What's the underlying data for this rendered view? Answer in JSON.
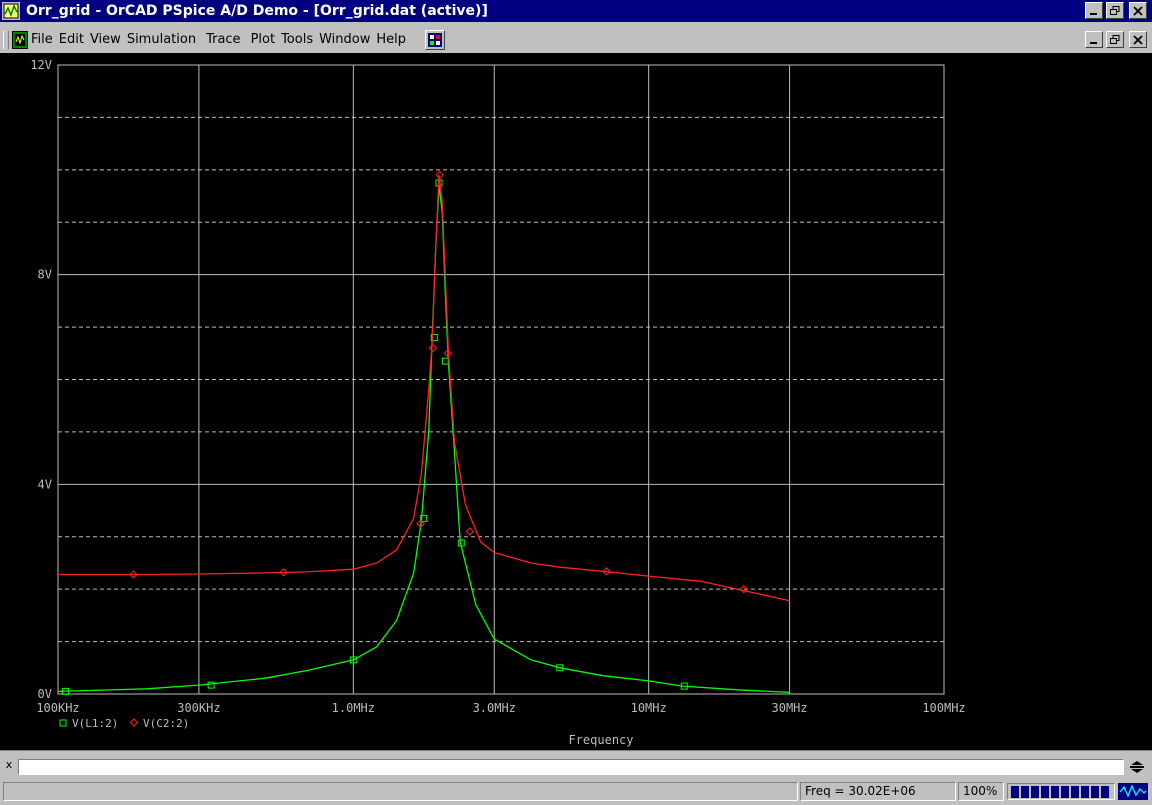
{
  "window": {
    "title": "Orr_grid - OrCAD PSpice A/D Demo  - [Orr_grid.dat (active)]"
  },
  "menu": {
    "items": [
      "File",
      "Edit",
      "View",
      "Simulation",
      "Trace",
      "Plot",
      "Tools",
      "Window",
      "Help"
    ]
  },
  "colors": {
    "titlebar": "#000080",
    "plot_background": "#000000",
    "grid": "#bcbcbc",
    "trace_L1": "#00ff00",
    "trace_C2": "#ff2020"
  },
  "icons": {
    "app": "pspice-app-icon",
    "document": "pspice-document-icon",
    "probe": "probe-icon",
    "waveform": "waveform-icon"
  },
  "chart_data": {
    "type": "line",
    "xlabel": "Frequency",
    "xscale": "log",
    "xlim": [
      100000,
      100000000
    ],
    "ylim": [
      0,
      12
    ],
    "x_ticks": [
      {
        "value": 100000,
        "label": "100KHz"
      },
      {
        "value": 300000,
        "label": "300KHz"
      },
      {
        "value": 1000000,
        "label": "1.0MHz"
      },
      {
        "value": 3000000,
        "label": "3.0MHz"
      },
      {
        "value": 10000000,
        "label": "10MHz"
      },
      {
        "value": 30000000,
        "label": "30MHz"
      },
      {
        "value": 100000000,
        "label": "100MHz"
      }
    ],
    "y_ticks": [
      {
        "value": 0,
        "label": "0V"
      },
      {
        "value": 4,
        "label": "4V"
      },
      {
        "value": 8,
        "label": "8V"
      },
      {
        "value": 12,
        "label": "12V"
      }
    ],
    "grid": true,
    "legend_position": "bottom-left",
    "series": [
      {
        "name": "V(L1:2)",
        "marker": "square",
        "color": "#00ff00",
        "points": [
          [
            100000,
            0.05
          ],
          [
            200000,
            0.1
          ],
          [
            300000,
            0.17
          ],
          [
            500000,
            0.3
          ],
          [
            700000,
            0.45
          ],
          [
            1000000,
            0.65
          ],
          [
            1200000,
            0.9
          ],
          [
            1400000,
            1.4
          ],
          [
            1600000,
            2.3
          ],
          [
            1700000,
            3.3
          ],
          [
            1800000,
            5.0
          ],
          [
            1850000,
            6.8
          ],
          [
            1900000,
            8.5
          ],
          [
            1950000,
            9.7
          ],
          [
            2000000,
            9.2
          ],
          [
            2050000,
            7.6
          ],
          [
            2100000,
            6.3
          ],
          [
            2200000,
            4.6
          ],
          [
            2300000,
            2.9
          ],
          [
            2600000,
            1.7
          ],
          [
            3000000,
            1.05
          ],
          [
            4000000,
            0.65
          ],
          [
            5000000,
            0.5
          ],
          [
            7000000,
            0.35
          ],
          [
            10000000,
            0.25
          ],
          [
            13000000,
            0.15
          ],
          [
            20000000,
            0.08
          ],
          [
            30000000,
            0.03
          ]
        ],
        "markers_at": [
          [
            106000,
            0.05
          ],
          [
            330000,
            0.17
          ],
          [
            1000000,
            0.65
          ],
          [
            1730000,
            3.35
          ],
          [
            1880000,
            6.8
          ],
          [
            1950000,
            9.75
          ],
          [
            2050000,
            6.35
          ],
          [
            2320000,
            2.88
          ],
          [
            5000000,
            0.5
          ],
          [
            13200000,
            0.15
          ]
        ]
      },
      {
        "name": "V(C2:2)",
        "marker": "diamond",
        "color": "#ff2020",
        "points": [
          [
            100000,
            2.28
          ],
          [
            200000,
            2.28
          ],
          [
            300000,
            2.29
          ],
          [
            500000,
            2.31
          ],
          [
            700000,
            2.33
          ],
          [
            1000000,
            2.38
          ],
          [
            1200000,
            2.5
          ],
          [
            1400000,
            2.75
          ],
          [
            1600000,
            3.35
          ],
          [
            1700000,
            4.2
          ],
          [
            1800000,
            5.8
          ],
          [
            1850000,
            6.7
          ],
          [
            1900000,
            8.5
          ],
          [
            1950000,
            9.9
          ],
          [
            2000000,
            9.4
          ],
          [
            2050000,
            7.9
          ],
          [
            2100000,
            6.5
          ],
          [
            2200000,
            4.8
          ],
          [
            2400000,
            3.6
          ],
          [
            2700000,
            2.9
          ],
          [
            3000000,
            2.7
          ],
          [
            4000000,
            2.5
          ],
          [
            5000000,
            2.42
          ],
          [
            7000000,
            2.34
          ],
          [
            10000000,
            2.25
          ],
          [
            15000000,
            2.15
          ],
          [
            20000000,
            2.0
          ],
          [
            30000000,
            1.78
          ]
        ],
        "markers_at": [
          [
            180000,
            2.28
          ],
          [
            580000,
            2.32
          ],
          [
            1690000,
            3.25
          ],
          [
            1860000,
            6.6
          ],
          [
            1960000,
            9.9
          ],
          [
            2090000,
            6.5
          ],
          [
            2480000,
            3.1
          ],
          [
            7200000,
            2.34
          ],
          [
            21000000,
            2.0
          ]
        ]
      }
    ]
  },
  "cmdline": {
    "close_label": "x",
    "value": ""
  },
  "status": {
    "freq_text": "Freq = 30.02E+06",
    "zoom": "100%",
    "progress_segments": 10
  }
}
